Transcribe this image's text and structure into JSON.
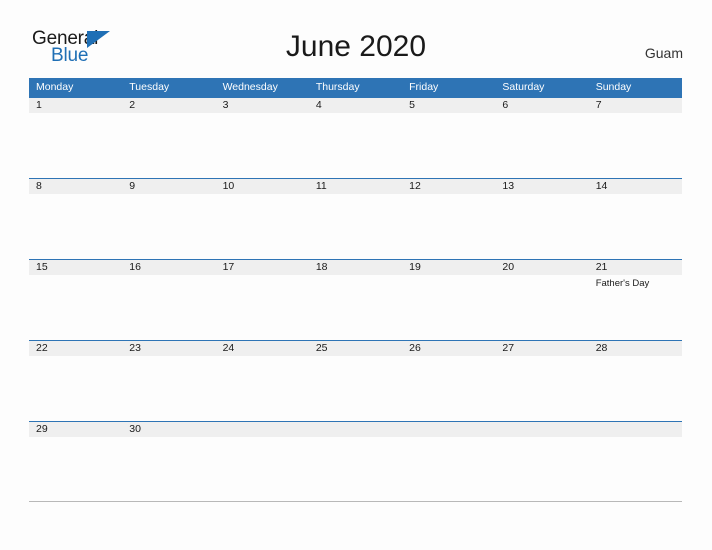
{
  "branding": {
    "logo_text_primary": "General",
    "logo_text_secondary": "Blue",
    "logo_triangle_icon": "triangle-icon",
    "accent_color": "#2e74b5",
    "logo_blue_color": "#1f6fb5"
  },
  "header": {
    "title": "June 2020",
    "region": "Guam"
  },
  "calendar": {
    "month": "June",
    "year": "2020",
    "band_color": "#efefef",
    "header_color": "#2e74b5",
    "day_names": [
      "Monday",
      "Tuesday",
      "Wednesday",
      "Thursday",
      "Friday",
      "Saturday",
      "Sunday"
    ],
    "weeks": [
      [
        {
          "date": "1",
          "event": ""
        },
        {
          "date": "2",
          "event": ""
        },
        {
          "date": "3",
          "event": ""
        },
        {
          "date": "4",
          "event": ""
        },
        {
          "date": "5",
          "event": ""
        },
        {
          "date": "6",
          "event": ""
        },
        {
          "date": "7",
          "event": ""
        }
      ],
      [
        {
          "date": "8",
          "event": ""
        },
        {
          "date": "9",
          "event": ""
        },
        {
          "date": "10",
          "event": ""
        },
        {
          "date": "11",
          "event": ""
        },
        {
          "date": "12",
          "event": ""
        },
        {
          "date": "13",
          "event": ""
        },
        {
          "date": "14",
          "event": ""
        }
      ],
      [
        {
          "date": "15",
          "event": ""
        },
        {
          "date": "16",
          "event": ""
        },
        {
          "date": "17",
          "event": ""
        },
        {
          "date": "18",
          "event": ""
        },
        {
          "date": "19",
          "event": ""
        },
        {
          "date": "20",
          "event": ""
        },
        {
          "date": "21",
          "event": "Father's Day"
        }
      ],
      [
        {
          "date": "22",
          "event": ""
        },
        {
          "date": "23",
          "event": ""
        },
        {
          "date": "24",
          "event": ""
        },
        {
          "date": "25",
          "event": ""
        },
        {
          "date": "26",
          "event": ""
        },
        {
          "date": "27",
          "event": ""
        },
        {
          "date": "28",
          "event": ""
        }
      ],
      [
        {
          "date": "29",
          "event": ""
        },
        {
          "date": "30",
          "event": ""
        },
        {
          "date": "",
          "event": ""
        },
        {
          "date": "",
          "event": ""
        },
        {
          "date": "",
          "event": ""
        },
        {
          "date": "",
          "event": ""
        },
        {
          "date": "",
          "event": ""
        }
      ]
    ]
  }
}
